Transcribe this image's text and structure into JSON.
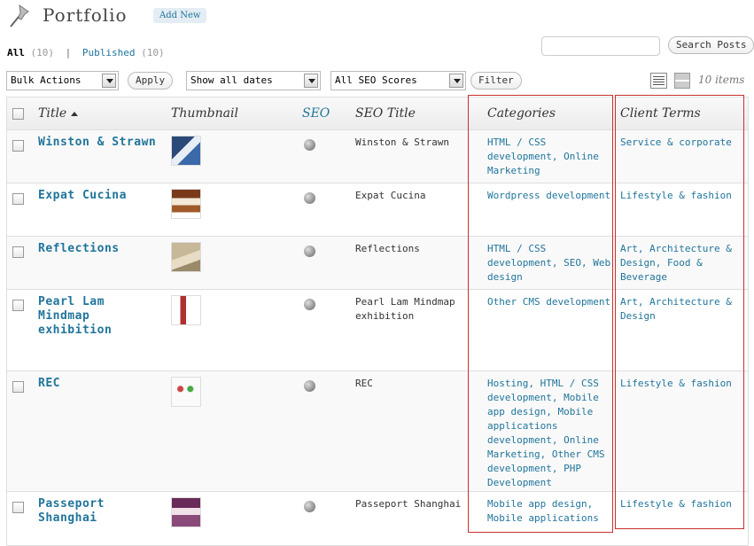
{
  "header": {
    "title": "Portfolio",
    "add_new_label": "Add New"
  },
  "filters": {
    "all_label": "All",
    "all_count": "(10)",
    "published_label": "Published",
    "published_count": "(10)"
  },
  "search": {
    "value": "",
    "button_label": "Search Posts"
  },
  "toolbar": {
    "bulk_actions": "Bulk Actions",
    "apply_label": "Apply",
    "dates": "Show all dates",
    "seo_scores": "All SEO Scores",
    "filter_label": "Filter",
    "items_count": "10 items"
  },
  "columns": {
    "title": "Title",
    "thumbnail": "Thumbnail",
    "seo": "SEO",
    "seo_title": "SEO Title",
    "categories": "Categories",
    "client_terms": "Client Terms"
  },
  "colors": {
    "link": "#21759b",
    "highlight_box": "#c9302c"
  },
  "rows": [
    {
      "title": "Winston & Strawn",
      "seo_title": "Winston & Strawn",
      "categories": "HTML / CSS development, Online Marketing",
      "client_terms": "Service & corporate"
    },
    {
      "title": "Expat Cucina",
      "seo_title": "Expat Cucina",
      "categories": "Wordpress development",
      "client_terms": "Lifestyle & fashion"
    },
    {
      "title": "Reflections",
      "seo_title": "Reflections",
      "categories": "HTML / CSS development, SEO, Web design",
      "client_terms": "Art, Architecture & Design, Food & Beverage"
    },
    {
      "title": "Pearl Lam Mindmap exhibition",
      "seo_title": "Pearl Lam Mindmap exhibition",
      "categories": "Other CMS development",
      "client_terms": "Art, Architecture & Design"
    },
    {
      "title": "REC",
      "seo_title": "REC",
      "categories": "Hosting, HTML / CSS development, Mobile app design, Mobile applications development, Online Marketing, Other CMS development, PHP Development",
      "client_terms": "Lifestyle & fashion"
    },
    {
      "title": "Passeport Shanghai",
      "seo_title": "Passeport Shanghai",
      "categories": "Mobile app design, Mobile applications",
      "client_terms": "Lifestyle & fashion"
    }
  ]
}
